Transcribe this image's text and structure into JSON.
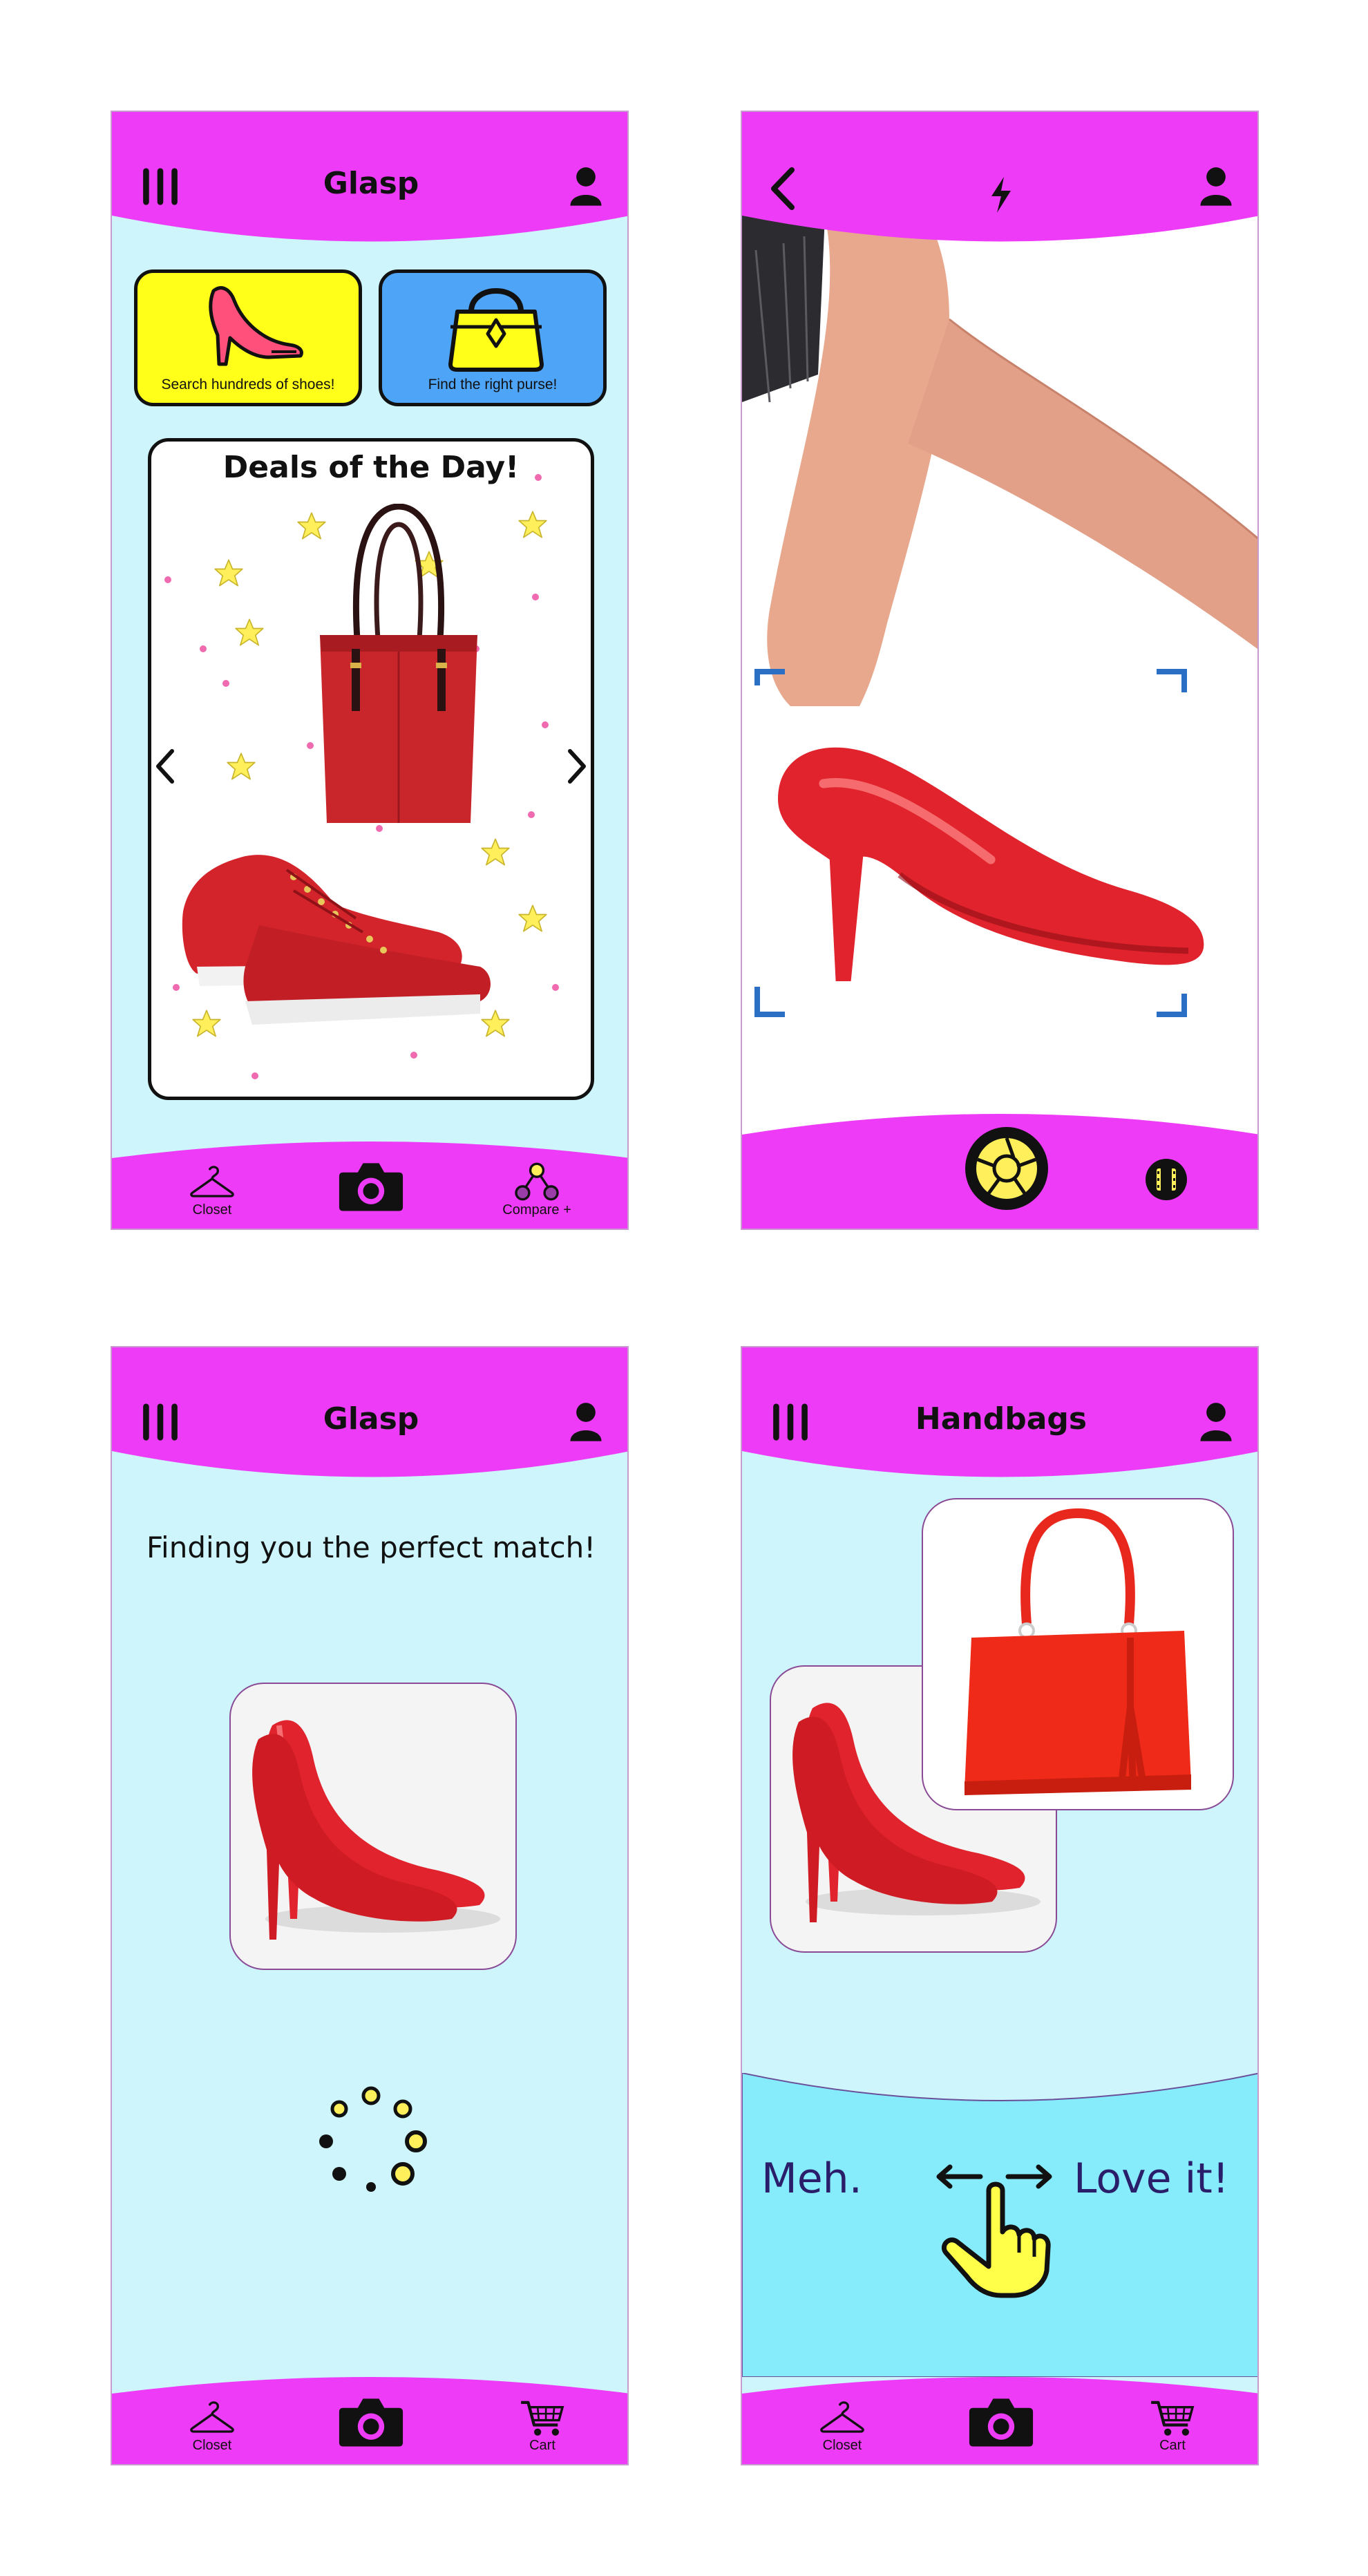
{
  "colors": {
    "magenta": "#ee3bf7",
    "light_cyan": "#cdf5fb",
    "swipe_cyan": "#86ecfb",
    "yellow": "#ffff1a",
    "blue": "#4ea4f7",
    "scan_blue": "#2a6fc4",
    "shoe_red": "#d9222a",
    "loader_yellow": "#ffef5a"
  },
  "screen_home": {
    "title": "Glasp",
    "icons": {
      "menu": "menu-icon",
      "profile": "user-icon"
    },
    "tiles": [
      {
        "label": "Search hundreds of shoes!",
        "icon": "high-heel-icon"
      },
      {
        "label": "Find the right purse!",
        "icon": "handbag-icon"
      }
    ],
    "deals_title": "Deals of the Day!",
    "footer": {
      "left_label": "Closet",
      "right_label": "Compare +"
    }
  },
  "screen_camera": {
    "icons": {
      "back": "back-arrow-icon",
      "flash": "flash-icon",
      "profile": "user-icon",
      "shutter": "shutter-icon",
      "video": "film-icon"
    }
  },
  "screen_loading": {
    "title": "Glasp",
    "message": "Finding you the perfect match!",
    "footer": {
      "left_label": "Closet",
      "right_label": "Cart"
    }
  },
  "screen_handbags": {
    "title": "Handbags",
    "swipe": {
      "left": "Meh.",
      "right": "Love it!"
    },
    "footer": {
      "left_label": "Closet",
      "right_label": "Cart"
    }
  }
}
